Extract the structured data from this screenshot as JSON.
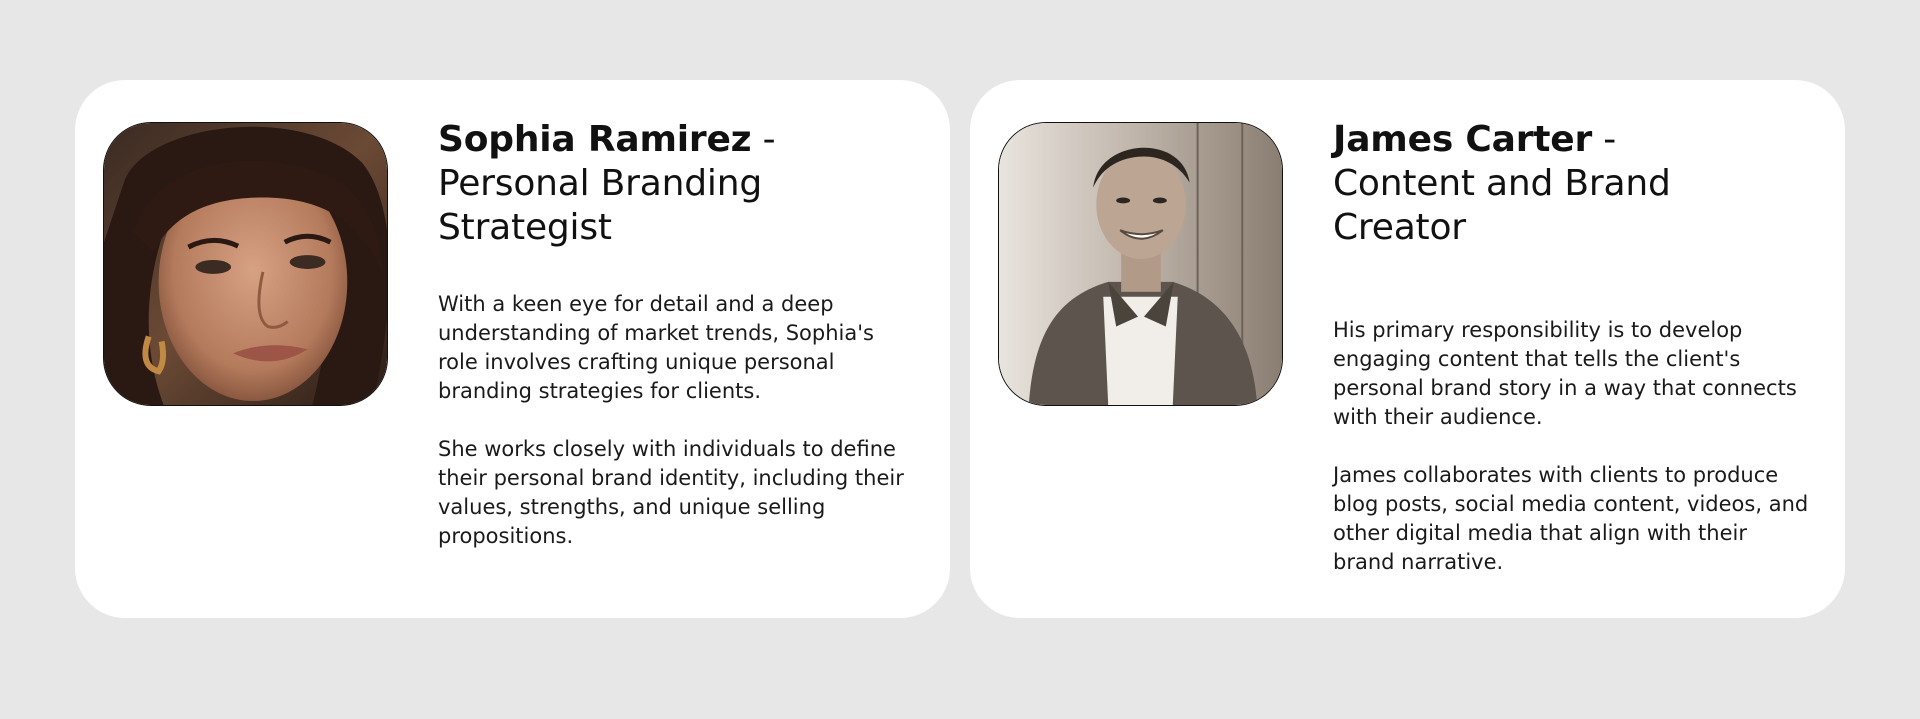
{
  "cards": [
    {
      "name": "Sophia Ramirez",
      "separator": " -",
      "role": "Personal Branding Strategist",
      "photo_icon": "portrait-woman-photo",
      "paragraphs": [
        "With a keen eye for detail and a deep understanding of market trends, Sophia's role involves crafting unique personal branding strategies for clients.",
        "She works closely with individuals to define their personal brand identity, including their values, strengths, and unique selling propositions."
      ]
    },
    {
      "name": "James Carter",
      "separator": " -",
      "role": "Content and Brand Creator",
      "photo_icon": "portrait-man-photo",
      "paragraphs": [
        "His primary responsibility is to develop engaging content that tells the client's personal brand story in a way that connects with their audience.",
        "James collaborates with clients to produce blog posts, social media content, videos, and other digital media that align with their brand narrative."
      ]
    }
  ]
}
